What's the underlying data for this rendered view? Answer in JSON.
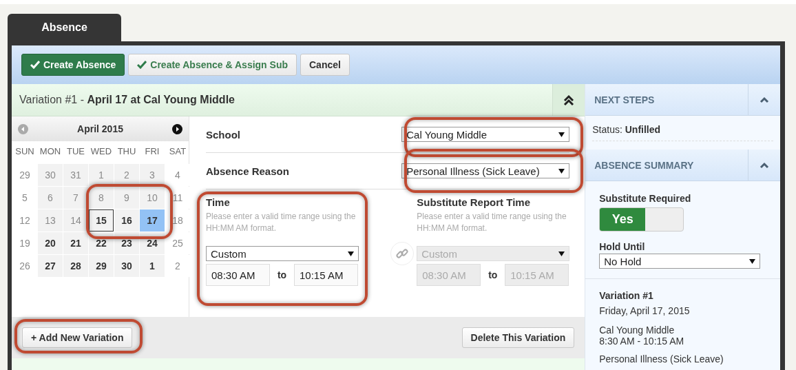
{
  "tab": {
    "label": "Absence",
    "selected": true
  },
  "toolbar": [
    {
      "label": "Create Absence",
      "kind": "primary",
      "check": true
    },
    {
      "label": "Create Absence & Assign Sub",
      "kind": "secondary",
      "check": true
    },
    {
      "label": "Cancel",
      "kind": "plain",
      "check": false
    }
  ],
  "variation_header": {
    "title": "Variation #1 - **April 17  at  Cal Young Middle**",
    "expanded": true
  },
  "calendar": {
    "month": "April 2015",
    "highlighted": true,
    "weekdays": [
      "SUN",
      "MON",
      "TUE",
      "WED",
      "THU",
      "FRI",
      "SAT"
    ],
    "weeks": [
      [
        {
          "day": "29",
          "disabled": true
        },
        {
          "day": "30",
          "disabled": true
        },
        {
          "day": "31",
          "disabled": true
        },
        {
          "day": "1",
          "disabled": true
        },
        {
          "day": "2",
          "disabled": true
        },
        {
          "day": "3",
          "disabled": true
        },
        {
          "day": "4",
          "disabled": true
        }
      ],
      [
        {
          "day": "5",
          "disabled": true
        },
        {
          "day": "6",
          "disabled": true
        },
        {
          "day": "7",
          "disabled": true
        },
        {
          "day": "8",
          "disabled": true
        },
        {
          "day": "9",
          "disabled": true
        },
        {
          "day": "10",
          "disabled": true
        },
        {
          "day": "11",
          "disabled": true
        }
      ],
      [
        {
          "day": "12",
          "disabled": true
        },
        {
          "day": "13",
          "disabled": true
        },
        {
          "day": "14",
          "disabled": true
        },
        {
          "day": "15",
          "disabled": false,
          "today": true
        },
        {
          "day": "16",
          "disabled": false
        },
        {
          "day": "17",
          "disabled": false,
          "selected": true
        },
        {
          "day": "18",
          "disabled": true
        }
      ],
      [
        {
          "day": "19",
          "disabled": true
        },
        {
          "day": "20",
          "disabled": false
        },
        {
          "day": "21",
          "disabled": false
        },
        {
          "day": "22",
          "disabled": false
        },
        {
          "day": "23",
          "disabled": false
        },
        {
          "day": "24",
          "disabled": false
        },
        {
          "day": "25",
          "disabled": true
        }
      ],
      [
        {
          "day": "26",
          "disabled": true
        },
        {
          "day": "27",
          "disabled": false
        },
        {
          "day": "28",
          "disabled": false
        },
        {
          "day": "29",
          "disabled": false
        },
        {
          "day": "30",
          "disabled": false
        },
        {
          "day": "1",
          "disabled": false
        },
        {
          "day": "2",
          "disabled": true
        }
      ]
    ]
  },
  "school": {
    "label": "School",
    "value": "Cal Young Middle",
    "highlighted": true
  },
  "absence_reason": {
    "label": "Absence Reason",
    "value": "Personal Illness (Sick Leave)",
    "highlighted": true
  },
  "time_groups": [
    {
      "title": "Time",
      "hint": "Please enter a valid time range using the HH:MM AM format.",
      "preset": "Custom",
      "start": "08:30 AM",
      "separator": "to",
      "end": "10:15 AM",
      "disabled": false,
      "highlighted": true
    },
    {
      "title": "Substitute Report Time",
      "hint": "Please enter a valid time range using the HH:MM AM format.",
      "preset": "Custom",
      "start": "08:30 AM",
      "separator": "to",
      "end": "10:15 AM",
      "disabled": true,
      "highlighted": false
    }
  ],
  "footer": {
    "add_button": "+ Add New Variation",
    "add_highlighted": true,
    "delete_button": "Delete This Variation"
  },
  "sidebar": {
    "next_steps": {
      "title": "NEXT STEPS",
      "expanded": true,
      "status": "Status: **Unfilled**"
    },
    "absence_summary": {
      "title": "ABSENCE SUMMARY",
      "expanded": true,
      "substitute_required": {
        "label": "Substitute Required",
        "on": true,
        "on_text": "Yes"
      },
      "hold_until": {
        "label": "Hold Until",
        "value": "No Hold"
      },
      "variation": {
        "title": "Variation #1",
        "date": "Friday, April 17, 2015",
        "school": "Cal Young Middle",
        "time": "8:30 AM - 10:15 AM",
        "reason": "Personal Illness (Sick Leave)"
      }
    }
  }
}
